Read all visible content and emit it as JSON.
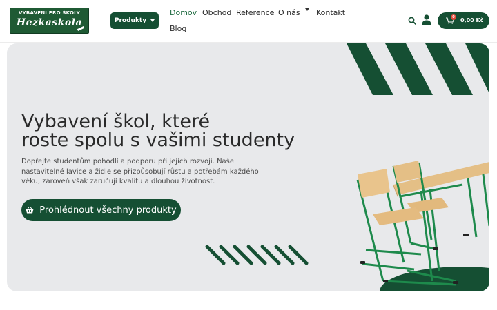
{
  "header": {
    "logo": {
      "line1": "VYBAVENÍ PRO ŠKOLY",
      "line2": "Hezkaskola"
    },
    "products_label": "Produkty",
    "nav": [
      {
        "label": "Domov",
        "active": true
      },
      {
        "label": "Obchod"
      },
      {
        "label": "Reference"
      },
      {
        "label": "O nás",
        "dropdown": true
      },
      {
        "label": "Kontakt"
      },
      {
        "label": "Blog"
      }
    ],
    "cart": {
      "count": "0",
      "total": "0,00 Kč"
    }
  },
  "hero": {
    "title_line1": "Vybavení škol, které",
    "title_line2": "roste spolu s vašimi studenty",
    "text": "Dopřejte studentům pohodlí a podporu při jejich rozvoji. Naše nastavitelné lavice a židle se přizpůsobují růstu a potřebám každého věku, zároveň však zaručují kvalitu a dlouhou životnost.",
    "cta_label": "Prohlédnout všechny produkty"
  },
  "colors": {
    "brand_green": "#154f33",
    "hero_bg": "#e8e9eb",
    "badge_red": "#e24b3b"
  },
  "icons": [
    "search-icon",
    "user-icon",
    "cart-icon",
    "basket-icon"
  ]
}
